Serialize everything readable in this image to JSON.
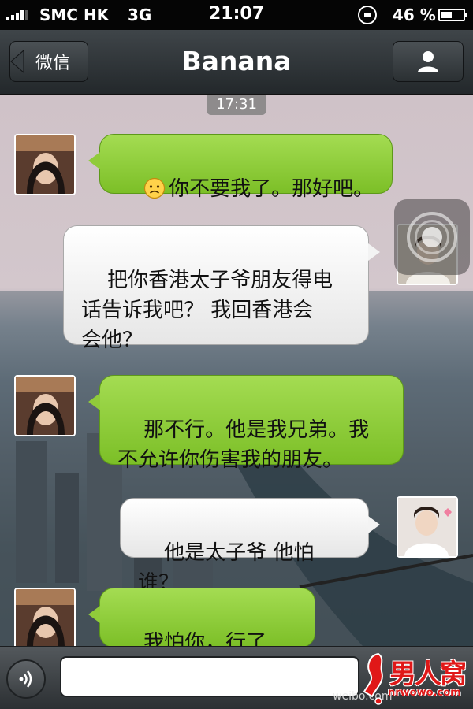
{
  "status_bar": {
    "carrier": "SMC HK",
    "network": "3G",
    "time": "21:07",
    "battery_percent": "46 %",
    "icons": [
      "signal-bars-icon",
      "rotation-lock-icon",
      "battery-icon"
    ]
  },
  "nav": {
    "back_label": "微信",
    "title": "Banana",
    "profile_icon": "person-icon"
  },
  "chat": {
    "timestamp": "17:31",
    "messages": [
      {
        "sender": "Banana",
        "side": "left",
        "style": "green",
        "emoji": "worried-face-icon",
        "text": "你不要我了。那好吧。"
      },
      {
        "sender": "me",
        "side": "right",
        "style": "white",
        "text": "把你香港太子爷朋友得电\n话告诉我吧？ 我回香港会\n会他？"
      },
      {
        "sender": "Banana",
        "side": "left",
        "style": "green",
        "text": "那不行。他是我兄弟。我\n不允许你伤害我的朋友。"
      },
      {
        "sender": "me",
        "side": "right",
        "style": "white",
        "text": "他是太子爷 他怕谁？"
      },
      {
        "sender": "Banana",
        "side": "left",
        "style": "green",
        "text": "我怕你，行了吧。"
      }
    ]
  },
  "input_bar": {
    "voice_icon": "voice-wave-icon",
    "input_value": "",
    "input_placeholder": ""
  },
  "watermarks": {
    "weibo": "weibo.com",
    "logo_text": "男人窝",
    "logo_url": "nrwowo.com"
  },
  "colors": {
    "bubble_green": "#8fd03b",
    "bubble_white": "#f5f5f5",
    "nav_bg": "#2f3437",
    "logo_red": "#e01818"
  }
}
